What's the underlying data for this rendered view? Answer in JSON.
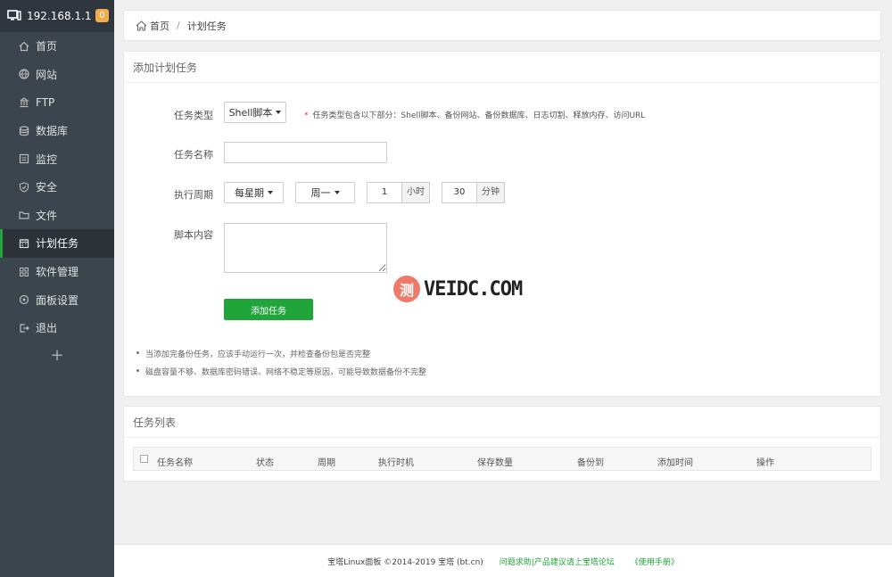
{
  "sidebar": {
    "host": "192.168.1.1",
    "badge": "0",
    "items": [
      {
        "label": "首页",
        "icon": "home-icon"
      },
      {
        "label": "网站",
        "icon": "globe-icon"
      },
      {
        "label": "FTP",
        "icon": "ftp-icon"
      },
      {
        "label": "数据库",
        "icon": "database-icon"
      },
      {
        "label": "监控",
        "icon": "monitor-icon"
      },
      {
        "label": "安全",
        "icon": "shield-icon"
      },
      {
        "label": "文件",
        "icon": "folder-icon"
      },
      {
        "label": "计划任务",
        "icon": "calendar-icon"
      },
      {
        "label": "软件管理",
        "icon": "grid-icon"
      },
      {
        "label": "面板设置",
        "icon": "settings-icon"
      },
      {
        "label": "退出",
        "icon": "logout-icon"
      }
    ],
    "add": "+"
  },
  "breadcrumb": {
    "home": "首页",
    "separator": "/",
    "current": "计划任务"
  },
  "form": {
    "title": "添加计划任务",
    "task_type_label": "任务类型",
    "task_type_value": "Shell脚本",
    "task_type_hint": "任务类型包含以下部分：Shell脚本、备份网站、备份数据库、日志切割、释放内存、访问URL",
    "hint_star": "*",
    "task_name_label": "任务名称",
    "task_name_value": "",
    "period_label": "执行周期",
    "period_value": "每星期",
    "weekday_value": "周一",
    "hour_value": "1",
    "hour_unit": "小时",
    "minute_value": "30",
    "minute_unit": "分钟",
    "script_label": "脚本内容",
    "submit": "添加任务",
    "notes": [
      "当添加完备份任务，应该手动运行一次，并检查备份包是否完整",
      "磁盘容量不够、数据库密码错误、网络不稳定等原因，可能导致数据备份不完整"
    ]
  },
  "watermark": {
    "seal": "测",
    "text": "VEIDC.COM"
  },
  "task_list": {
    "title": "任务列表",
    "columns": [
      "任务名称",
      "状态",
      "周期",
      "执行时机",
      "保存数量",
      "备份到",
      "添加时间",
      "操作"
    ]
  },
  "footer": {
    "copyright": "宝塔Linux面板 ©2014-2019 宝塔 (bt.cn)",
    "forum": "问题求助|产品建议请上宝塔论坛",
    "manual": "《使用手册》"
  }
}
